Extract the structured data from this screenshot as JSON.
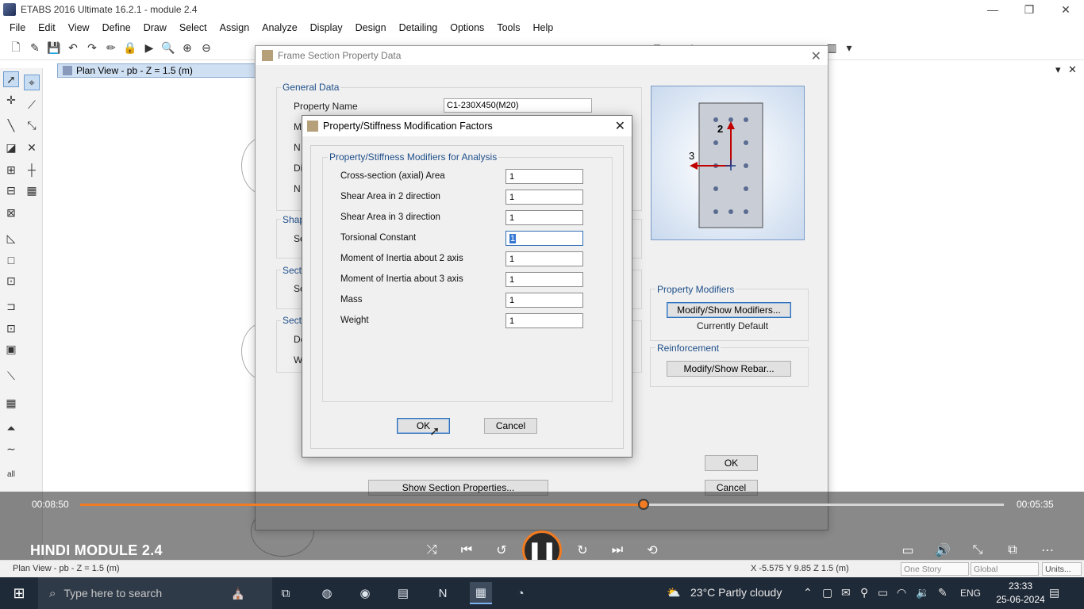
{
  "window": {
    "title": "ETABS 2016 Ultimate 16.2.1 - module 2.4",
    "controls": {
      "minimize": "—",
      "restore": "❐",
      "close": "✕"
    }
  },
  "menu": [
    "File",
    "Edit",
    "View",
    "Define",
    "Draw",
    "Select",
    "Assign",
    "Analyze",
    "Display",
    "Design",
    "Detailing",
    "Options",
    "Tools",
    "Help"
  ],
  "document_tab": {
    "label": "Plan View - pb - Z = 1.5 (m)",
    "dropdown": "▾",
    "close": "✕"
  },
  "frame_section_dialog": {
    "title": "Frame Section Property Data",
    "general_data": {
      "group_label": "General Data",
      "property_name_label": "Property Name",
      "property_name_value": "C1-230X450(M20)",
      "truncated_labels": [
        "M",
        "N",
        "Di",
        "N"
      ]
    },
    "shape_group": {
      "label": "Shap",
      "row": "Se"
    },
    "section_group_1": {
      "label": "Sectio",
      "row": "Sc"
    },
    "section_group_2": {
      "label": "Sectio",
      "rows": [
        "De",
        "W"
      ]
    },
    "preview": {
      "axis_2": "2",
      "axis_3": "3"
    },
    "property_modifiers": {
      "group_label": "Property Modifiers",
      "button": "Modify/Show Modifiers...",
      "status": "Currently Default"
    },
    "reinforcement": {
      "group_label": "Reinforcement",
      "button": "Modify/Show Rebar..."
    },
    "show_section_button": "Show Section Properties...",
    "ok": "OK",
    "cancel": "Cancel"
  },
  "modifiers_dialog": {
    "title": "Property/Stiffness Modification Factors",
    "group_label": "Property/Stiffness Modifiers for Analysis",
    "rows": [
      {
        "label": "Cross-section (axial) Area",
        "value": "1"
      },
      {
        "label": "Shear Area in 2 direction",
        "value": "1"
      },
      {
        "label": "Shear Area in 3 direction",
        "value": "1"
      },
      {
        "label": "Torsional Constant",
        "value": "1"
      },
      {
        "label": "Moment of Inertia about 2 axis",
        "value": "1"
      },
      {
        "label": "Moment of Inertia about 3 axis",
        "value": "1"
      },
      {
        "label": "Mass",
        "value": "1"
      },
      {
        "label": "Weight",
        "value": "1"
      }
    ],
    "ok": "OK",
    "cancel": "Cancel"
  },
  "player": {
    "elapsed": "00:08:50",
    "remaining": "00:05:35",
    "progress_fraction": 0.61,
    "video_title": "HINDI MODULE 2.4",
    "accent_color": "#f07b22"
  },
  "status_bar": {
    "left": "Plan View - pb - Z = 1.5 (m)",
    "coords": "X -5.575  Y 9.85  Z 1.5 (m)",
    "story_select": "One Story",
    "coord_select": "Global",
    "units_button": "Units..."
  },
  "taskbar": {
    "search_placeholder": "Type here to search",
    "weather": "23°C  Partly cloudy",
    "language": "ENG",
    "time": "23:33",
    "date": "25-06-2024"
  }
}
